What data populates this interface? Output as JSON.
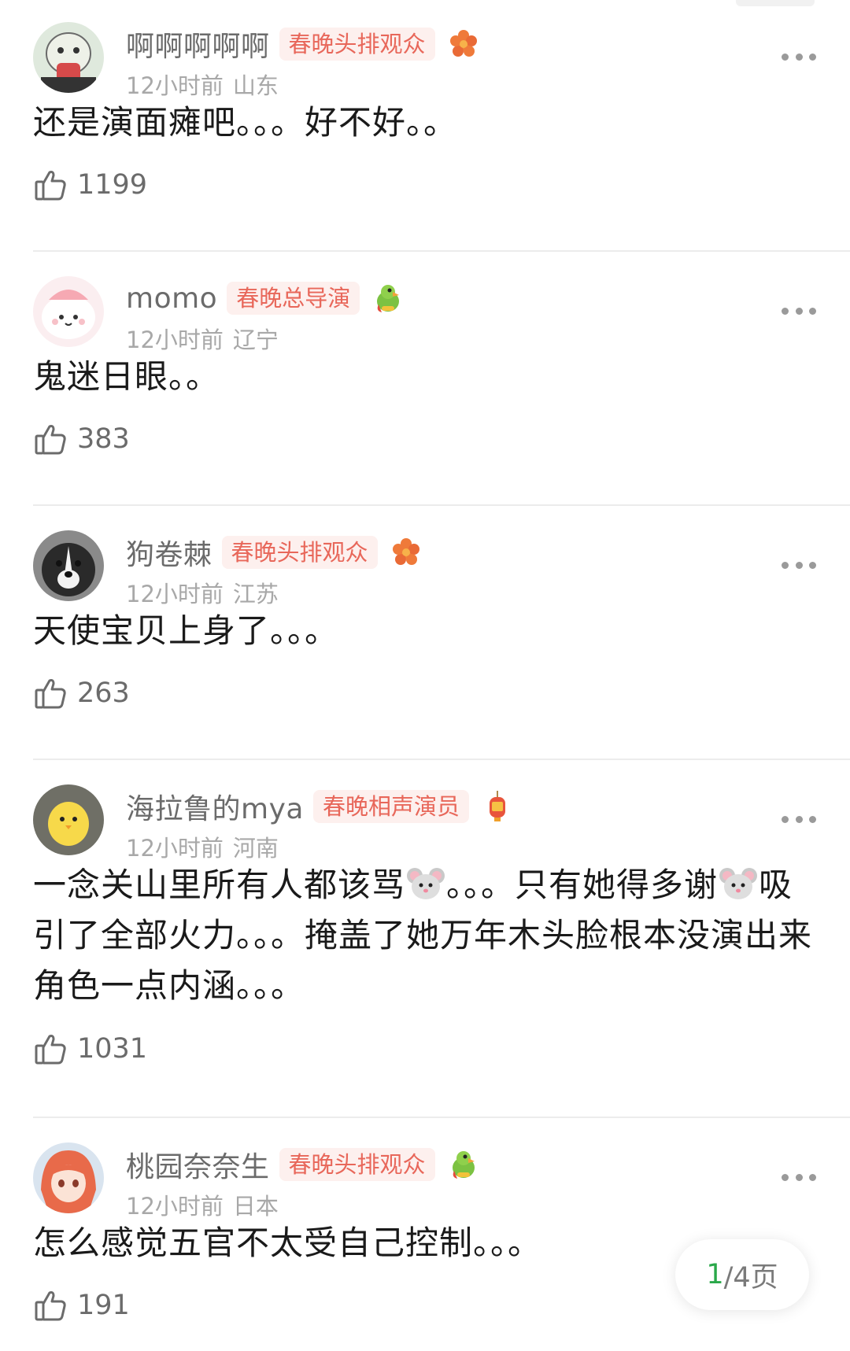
{
  "comments": [
    {
      "username": "啊啊啊啊啊",
      "badge": "春晚头排观众",
      "badge_icon": "flower-badge-icon",
      "time": "12小时前",
      "location": "山东",
      "content": "还是演面瘫吧。。。好不好。。",
      "likes": "1199"
    },
    {
      "username": "momo",
      "badge": "春晚总导演",
      "badge_icon": "parrot-badge-icon",
      "time": "12小时前",
      "location": "辽宁",
      "content": "鬼迷日眼。。",
      "likes": "383"
    },
    {
      "username": "狗卷棘",
      "badge": "春晚头排观众",
      "badge_icon": "flower-badge-icon",
      "time": "12小时前",
      "location": "江苏",
      "content": "天使宝贝上身了。。。",
      "likes": "263"
    },
    {
      "username": "海拉鲁的mya",
      "badge": "春晚相声演员",
      "badge_icon": "lantern-badge-icon",
      "time": "12小时前",
      "location": "河南",
      "content_parts": [
        "一念关山里所有人都该骂",
        "。。。只有她得多谢",
        "吸引了全部火力。。。掩盖了她万年木头脸根本没演出来角色一点内涵。。。"
      ],
      "likes": "1031"
    },
    {
      "username": "桃园奈奈生",
      "badge": "春晚头排观众",
      "badge_icon": "parrot-badge-icon",
      "time": "12小时前",
      "location": "日本",
      "content": "怎么感觉五官不太受自己控制。。。",
      "likes": "191"
    }
  ],
  "pager": {
    "current": "1",
    "rest": "/4页"
  },
  "colors": {
    "badge_text": "#e8675a",
    "badge_bg": "#fdf0ee",
    "pager_current": "#2aa84a"
  }
}
